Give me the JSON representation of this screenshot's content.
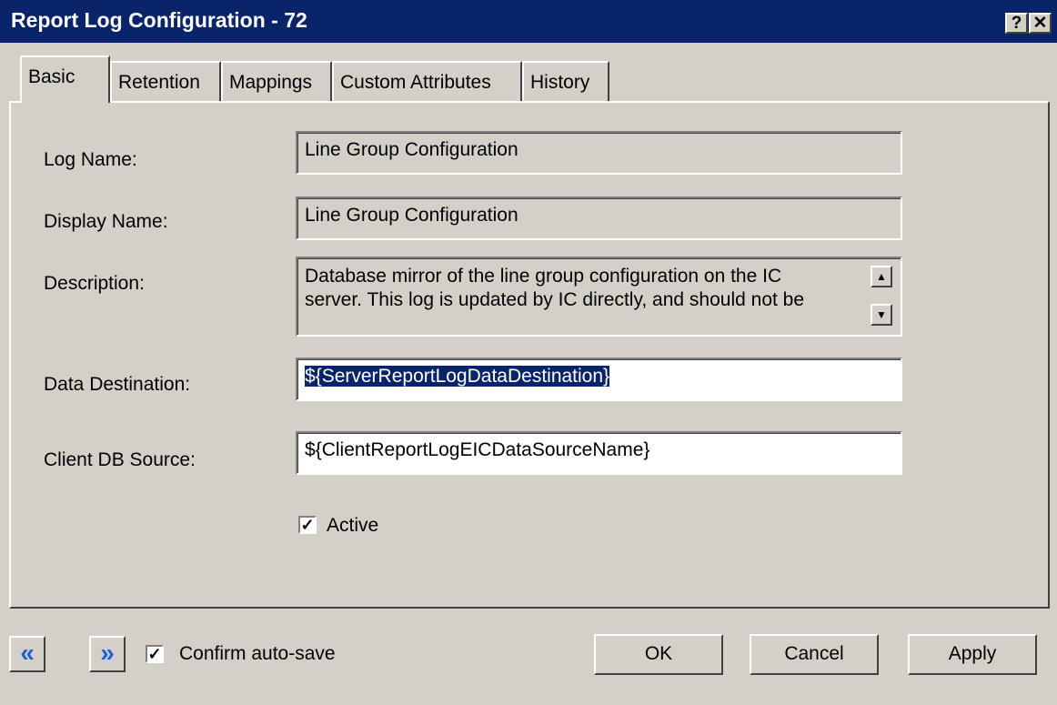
{
  "window": {
    "title": "Report Log Configuration - 72",
    "help_label": "?",
    "close_label": "✕"
  },
  "tabs": [
    {
      "label": "Basic",
      "active": true
    },
    {
      "label": "Retention"
    },
    {
      "label": "Mappings"
    },
    {
      "label": "Custom Attributes"
    },
    {
      "label": "History"
    }
  ],
  "form": {
    "log_name": {
      "label": "Log Name:",
      "value": "Line Group Configuration"
    },
    "display_name": {
      "label": "Display Name:",
      "value": "Line Group Configuration"
    },
    "description": {
      "label": "Description:",
      "line1": "Database mirror of the line group configuration on the IC",
      "line2": "server. This log is updated by IC directly, and should not be"
    },
    "data_destination": {
      "label": "Data Destination:",
      "value": "${ServerReportLogDataDestination}"
    },
    "client_db_source": {
      "label": "Client DB Source:",
      "value": "${ClientReportLogEICDataSourceName}"
    },
    "active": {
      "label": "Active",
      "checked": true
    }
  },
  "footer": {
    "prev_icon": "«",
    "next_icon": "»",
    "confirm_autosave": {
      "label": "Confirm auto-save",
      "checked": true
    },
    "ok_label": "OK",
    "cancel_label": "Cancel",
    "apply_label": "Apply"
  },
  "colors": {
    "titlebar": "#0a246a",
    "face": "#d4d0c8",
    "selection": "#0a246a",
    "nav_arrow": "#1f5fd6"
  }
}
